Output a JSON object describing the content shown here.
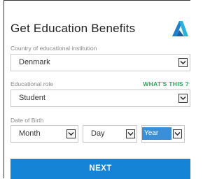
{
  "form": {
    "title": "Get Education Benefits",
    "logo_icon": "autodesk-logo-icon",
    "country": {
      "label": "Country of educational institution",
      "value": "Denmark"
    },
    "role": {
      "label": "Educational role",
      "value": "Student",
      "help_link": "WHAT'S THIS ?"
    },
    "dob": {
      "label": "Date of Birth",
      "month": "Month",
      "day": "Day",
      "year": "Year"
    },
    "next_label": "NEXT"
  },
  "colors": {
    "accent": "#1684d6",
    "link": "#22a85a",
    "selection": "#3b8fd8"
  }
}
